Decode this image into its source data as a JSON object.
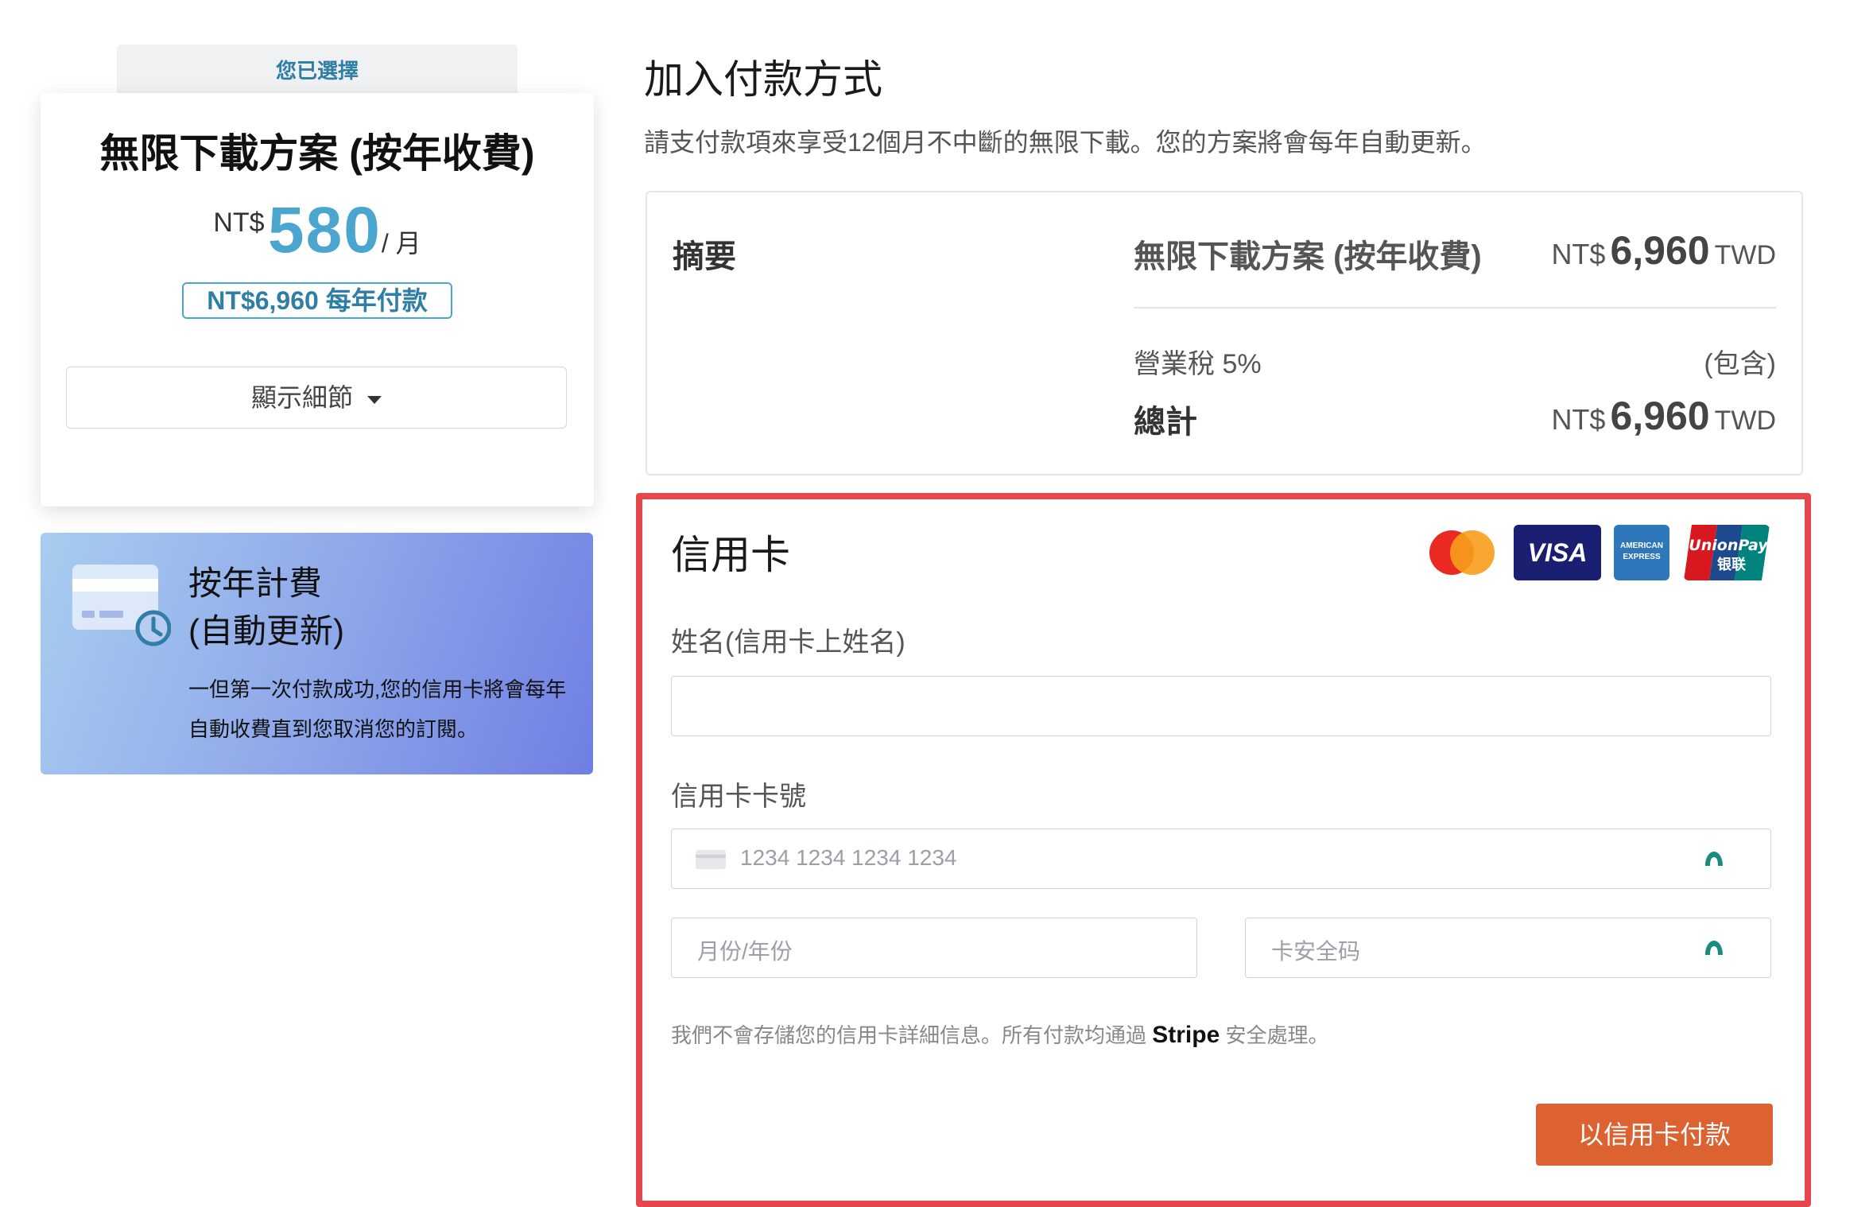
{
  "plan_card": {
    "selected_tab": "您已選擇",
    "title": "無限下載方案 (按年收費)",
    "price_currency": "NT$",
    "price_amount": "580",
    "price_unit": "/ 月",
    "yearly_badge": "NT$6,960 每年付款",
    "show_details_label": "顯示細節"
  },
  "billing_info": {
    "title_line1": "按年計費",
    "title_line2": "(自動更新)",
    "description": "一但第一次付款成功,您的信用卡將會每年自動收費直到您取消您的訂閱。"
  },
  "checkout": {
    "title": "加入付款方式",
    "subtitle": "請支付款項來享受12個月不中斷的無限下載。您的方案將會每年自動更新。"
  },
  "summary": {
    "label": "摘要",
    "plan_name": "無限下載方案 (按年收費)",
    "plan_currency": "NT$",
    "plan_amount": "6,960",
    "plan_code": "TWD",
    "tax_label": "營業稅 5%",
    "tax_value": "(包含)",
    "total_label": "總計",
    "total_currency": "NT$",
    "total_amount": "6,960",
    "total_code": "TWD"
  },
  "credit_card": {
    "title": "信用卡",
    "brands": [
      "mastercard-icon",
      "visa-icon",
      "amex-icon",
      "unionpay-icon"
    ],
    "visa_text": "VISA",
    "amex_text": "AMERICAN EXPRESS",
    "unionpay_text": "UnionPay",
    "unionpay_cn": "银联",
    "name_label": "姓名(信用卡上姓名)",
    "name_value": "",
    "number_label": "信用卡卡號",
    "number_placeholder": "1234 1234 1234 1234",
    "expiry_placeholder": "月份/年份",
    "cvc_placeholder": "卡安全码",
    "disclaimer_pre": "我們不會存儲您的信用卡詳細信息。所有付款均通過",
    "disclaimer_brand": "Stripe",
    "disclaimer_post": "安全處理。",
    "pay_button": "以信用卡付款"
  },
  "colors": {
    "accent_blue": "#4aa6cf",
    "highlight_red": "#e5474c",
    "pay_orange": "#dd6232"
  }
}
